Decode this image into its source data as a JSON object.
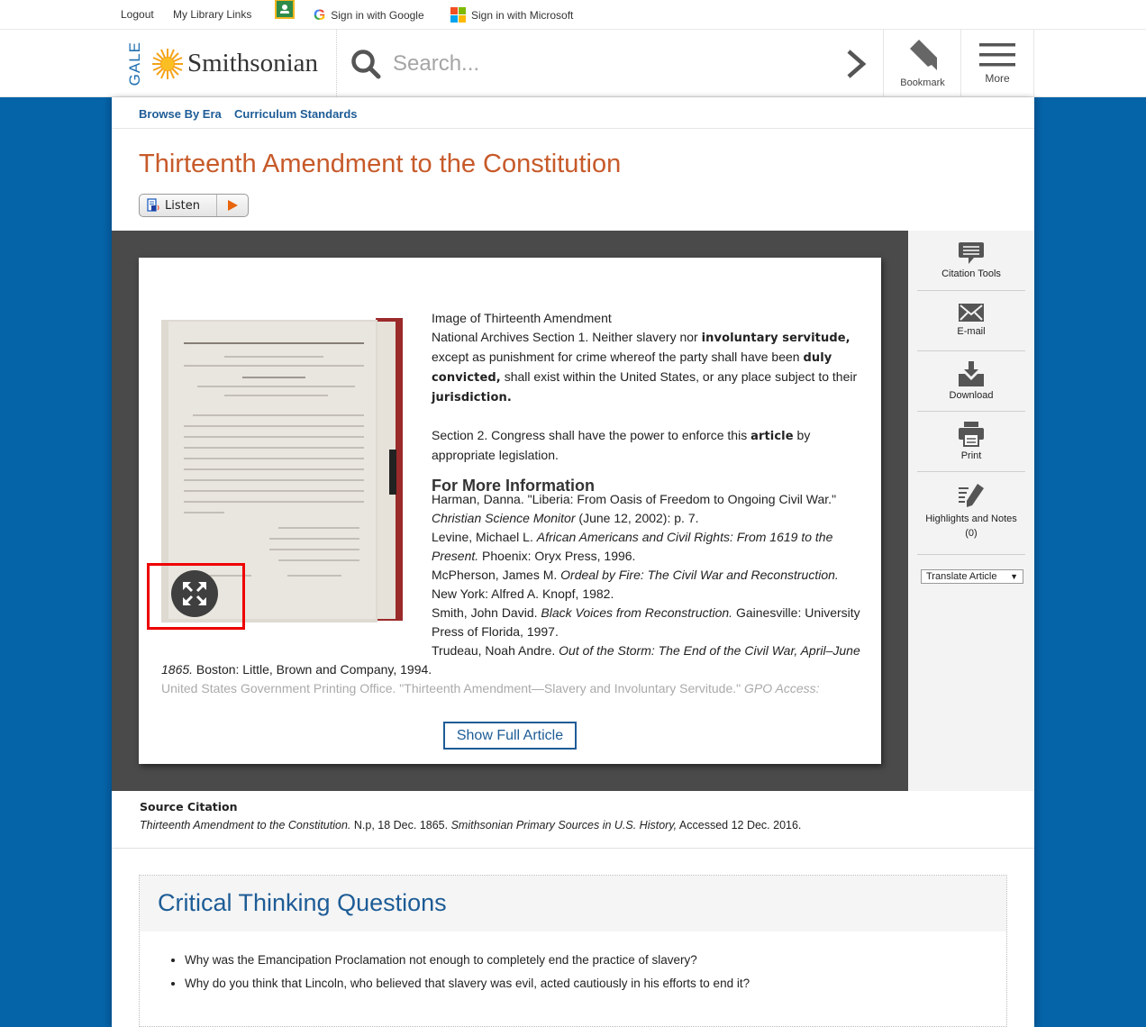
{
  "utility_bar": {
    "logout": "Logout",
    "library_links": "My Library Links",
    "google_signin": "Sign in with Google",
    "microsoft_signin": "Sign in with Microsoft"
  },
  "header": {
    "logo_gale": "GALE",
    "logo_brand": "Smithsonian",
    "search_placeholder": "Search...",
    "bookmark_label": "Bookmark",
    "more_label": "More"
  },
  "subnav": {
    "items": [
      "Browse By Era",
      "Curriculum Standards"
    ]
  },
  "article": {
    "title": "Thirteenth Amendment to the Constitution",
    "listen_label": "Listen",
    "caption": "Image of Thirteenth Amendment",
    "section1": {
      "prefix": " National Archives Section 1. Neither slavery nor ",
      "term1": "involuntary servitude,",
      "mid1": " except as punishment for crime whereof the party shall have been ",
      "term2": "duly convicted,",
      "mid2": " shall exist within the United States, or any place subject to their ",
      "term3": "jurisdiction."
    },
    "section2": {
      "prefix": "Section 2. Congress shall have the power to enforce this ",
      "term": "article",
      "suffix": " by appropriate legislation."
    },
    "more_info_heading": "For More Information",
    "references": [
      {
        "plain1": "Harman, Danna. \"Liberia: From Oasis of Freedom to Ongoing Civil War.\" ",
        "italic": "Christian Science Monitor",
        "plain2": " (June 12, 2002): p. 7."
      },
      {
        "plain1": "Levine, Michael L. ",
        "italic": "African Americans and Civil Rights: From 1619 to the Present.",
        "plain2": " Phoenix: Oryx Press, 1996."
      },
      {
        "plain1": "McPherson, James M. ",
        "italic": "Ordeal by Fire: The Civil War and Reconstruction.",
        "plain2": " New York: Alfred A. Knopf, 1982."
      },
      {
        "plain1": "Smith, John David. ",
        "italic": "Black Voices from Reconstruction.",
        "plain2": " Gainesville: University Press of Florida, 1997."
      },
      {
        "plain1": "Trudeau, Noah Andre. ",
        "italic": "Out of the Storm: The End of the Civil War, April–June 1865.",
        "plain2": " Boston: Little, Brown and Company, 1994."
      },
      {
        "plain1": "United States Government Printing Office. \"Thirteenth Amendment—Slavery and Involuntary Servitude.\" ",
        "italic": "GPO Access:",
        "plain2": ""
      }
    ],
    "show_full_label": "Show Full Article"
  },
  "tools": {
    "citation": "Citation Tools",
    "email": "E-mail",
    "download": "Download",
    "print": "Print",
    "highlights": "Highlights and Notes",
    "highlights_count": "(0)",
    "translate": "Translate Article"
  },
  "source_citation": {
    "heading": "Source Citation",
    "title_italic": "Thirteenth Amendment to the Constitution.",
    "mid": " N.p, 18 Dec. 1865. ",
    "source_italic": "Smithsonian Primary Sources in U.S. History,",
    "accessed": " Accessed 12 Dec. 2016."
  },
  "critical_thinking": {
    "title": "Critical Thinking Questions",
    "questions": [
      "Why was the Emancipation Proclamation not enough to completely end the practice of slavery?",
      "Why do you think that Lincoln, who believed that slavery was evil, acted cautiously in his efforts to end it?"
    ]
  },
  "colors": {
    "brand_blue": "#0563a8",
    "link_blue": "#1d5c96",
    "title_orange": "#c75a2a",
    "viewer_dark": "#4a4a4a"
  }
}
